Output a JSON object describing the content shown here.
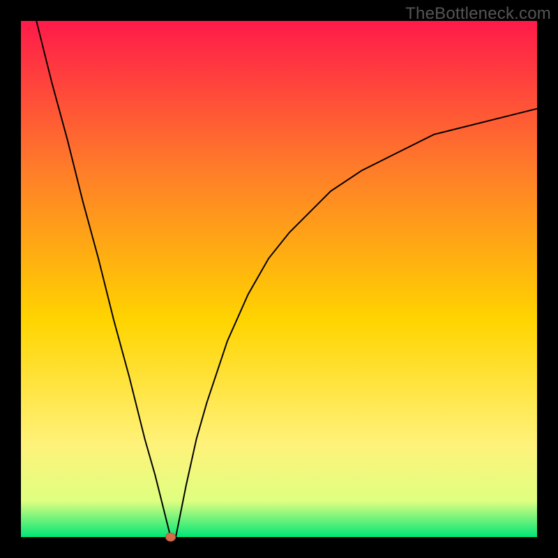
{
  "watermark": "TheBottleneck.com",
  "colors": {
    "gradient_top": "#ff1a4a",
    "gradient_mid_upper": "#ff7a2a",
    "gradient_mid": "#ffd400",
    "gradient_mid_lower": "#fff27a",
    "gradient_near_bottom": "#dfff80",
    "gradient_bottom": "#00e676",
    "curve": "#000000",
    "frame": "#000000",
    "marker_fill": "#d86b4a",
    "marker_stroke": "#b85538"
  },
  "chart_data": {
    "type": "line",
    "title": "",
    "xlabel": "",
    "ylabel": "",
    "xlim": [
      0,
      100
    ],
    "ylim": [
      0,
      100
    ],
    "grid": false,
    "legend": false,
    "annotations": [
      {
        "type": "marker",
        "x": 29,
        "y": 0,
        "shape": "circle",
        "color": "#d86b4a"
      }
    ],
    "series": [
      {
        "name": "bottleneck-curve",
        "segment": "left",
        "x": [
          3,
          6,
          9,
          12,
          15,
          18,
          21,
          24,
          26,
          27,
          28,
          29
        ],
        "y": [
          100,
          88,
          77,
          65,
          54,
          42,
          31,
          19,
          12,
          8,
          4,
          0
        ]
      },
      {
        "name": "bottleneck-curve",
        "segment": "floor",
        "x": [
          29,
          30
        ],
        "y": [
          0,
          0
        ]
      },
      {
        "name": "bottleneck-curve",
        "segment": "right",
        "x": [
          30,
          32,
          34,
          36,
          38,
          40,
          44,
          48,
          52,
          56,
          60,
          66,
          72,
          80,
          88,
          96,
          100
        ],
        "y": [
          0,
          10,
          19,
          26,
          32,
          38,
          47,
          54,
          59,
          63,
          67,
          71,
          74,
          78,
          80,
          82,
          83
        ]
      }
    ]
  }
}
